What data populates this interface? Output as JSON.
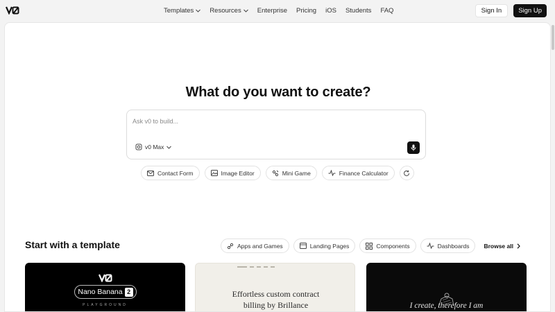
{
  "header": {
    "logo_icon": "v0-logo-icon",
    "nav": [
      {
        "label": "Templates",
        "has_dropdown": true
      },
      {
        "label": "Resources",
        "has_dropdown": true
      },
      {
        "label": "Enterprise",
        "has_dropdown": false
      },
      {
        "label": "Pricing",
        "has_dropdown": false
      },
      {
        "label": "iOS",
        "has_dropdown": false
      },
      {
        "label": "Students",
        "has_dropdown": false
      },
      {
        "label": "FAQ",
        "has_dropdown": false
      }
    ],
    "signin_label": "Sign In",
    "signup_label": "Sign Up"
  },
  "hero": {
    "title": "What do you want to create?",
    "prompt": {
      "placeholder": "Ask v0 to build...",
      "value": "",
      "model_label": "v0 Max",
      "model_icon": "model-cube-icon",
      "mic_icon": "microphone-icon"
    },
    "suggestions": [
      {
        "label": "Contact Form",
        "icon": "mail-icon"
      },
      {
        "label": "Image Editor",
        "icon": "image-icon"
      },
      {
        "label": "Mini Game",
        "icon": "game-icon"
      },
      {
        "label": "Finance Calculator",
        "icon": "activity-icon"
      }
    ],
    "refresh_icon": "refresh-icon"
  },
  "templates": {
    "title": "Start with a template",
    "filters": [
      {
        "label": "Apps and Games",
        "icon": "apps-icon"
      },
      {
        "label": "Landing Pages",
        "icon": "layout-icon"
      },
      {
        "label": "Components",
        "icon": "grid-icon"
      },
      {
        "label": "Dashboards",
        "icon": "activity-icon"
      }
    ],
    "browse_all": "Browse all",
    "cards": [
      {
        "badge_text": "Nano Banana",
        "badge_number": "2",
        "subtitle": "PLAYGROUND"
      },
      {
        "text_line1": "Effortless custom contract",
        "text_line2": "billing by Brillance"
      },
      {
        "text": "I create, therefore I am"
      }
    ]
  },
  "colors": {
    "page_bg": "#f3f3f3",
    "panel_bg": "#ffffff",
    "primary_dark": "#111111",
    "border": "#e2e2e2"
  }
}
